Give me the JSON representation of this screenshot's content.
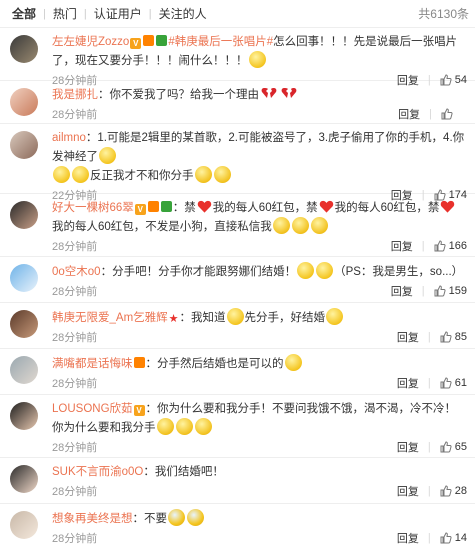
{
  "tabs": {
    "items": [
      "全部",
      "热门",
      "认证用户",
      "关注的人"
    ],
    "count": "共6130条"
  },
  "comments": [
    {
      "user": "左左婕児Zozzo",
      "topic": "#韩庚最后一张唱片#",
      "text_a": "怎么回事！！！先是说最后一张唱片了，现在又要分手！！！闹什么！！！",
      "time": "28分钟前",
      "reply": "回复",
      "likes": "54"
    },
    {
      "user": "我是挪扎",
      "text_a": "：你不爱我了吗？给我一个理由",
      "time": "28分钟前",
      "reply": "回复",
      "likes": ""
    },
    {
      "user": "ailmno",
      "text_a": "：1.可能是2辑里的某首歌，2.可能被盗号了，3.虎子偷用了你的手机，4.你发神经了",
      "text_b": "反正我才不和你分手",
      "time": "22分钟前",
      "reply": "回复",
      "likes": "174"
    },
    {
      "user": "好大一棵树66翠",
      "text_a": "：禁",
      "text_b": "我的每人60红包，禁",
      "text_c": "我的每人60红包，禁",
      "text_d": "我的每人60红包，不发是小狗，直接私信我",
      "time": "28分钟前",
      "reply": "回复",
      "likes": "166"
    },
    {
      "user": "0o空木o0",
      "text_a": "：分手吧！分手你才能跟努娜们结婚！",
      "text_b": "（PS：我是男生，so...）",
      "time": "28分钟前",
      "reply": "回复",
      "likes": "159"
    },
    {
      "user": "韩庚无限爱_Am乞雅辉",
      "text_a": "：我知道",
      "text_b": "先分手，好结婚",
      "time": "28分钟前",
      "reply": "回复",
      "likes": "85"
    },
    {
      "user": "满嘴都是话悔味",
      "text_a": "：分手然后结婚也是可以的",
      "time": "28分钟前",
      "reply": "回复",
      "likes": "61"
    },
    {
      "user": "LOUSONG欣茹",
      "text_a": "：你为什么要和我分手！不要问我饿不饿，渴不渴，冷不冷！你为什么要和我分手",
      "time": "28分钟前",
      "reply": "回复",
      "likes": "65"
    },
    {
      "user": "SUK不言而渝o0O",
      "text_a": "：我们结婚吧！",
      "time": "28分钟前",
      "reply": "回复",
      "likes": "28"
    },
    {
      "user": "想象再美终是想",
      "text_a": "：不要",
      "time": "28分钟前",
      "reply": "回复",
      "likes": "14"
    }
  ],
  "colors": {
    "accent": "#eb7350",
    "muted": "#999999",
    "border": "#eeeeee"
  },
  "icons": {
    "like": "thumbs-up-icon",
    "emoji": "emoticon-icon",
    "heart": "heart-icon",
    "broken_heart": "broken-heart-icon"
  }
}
